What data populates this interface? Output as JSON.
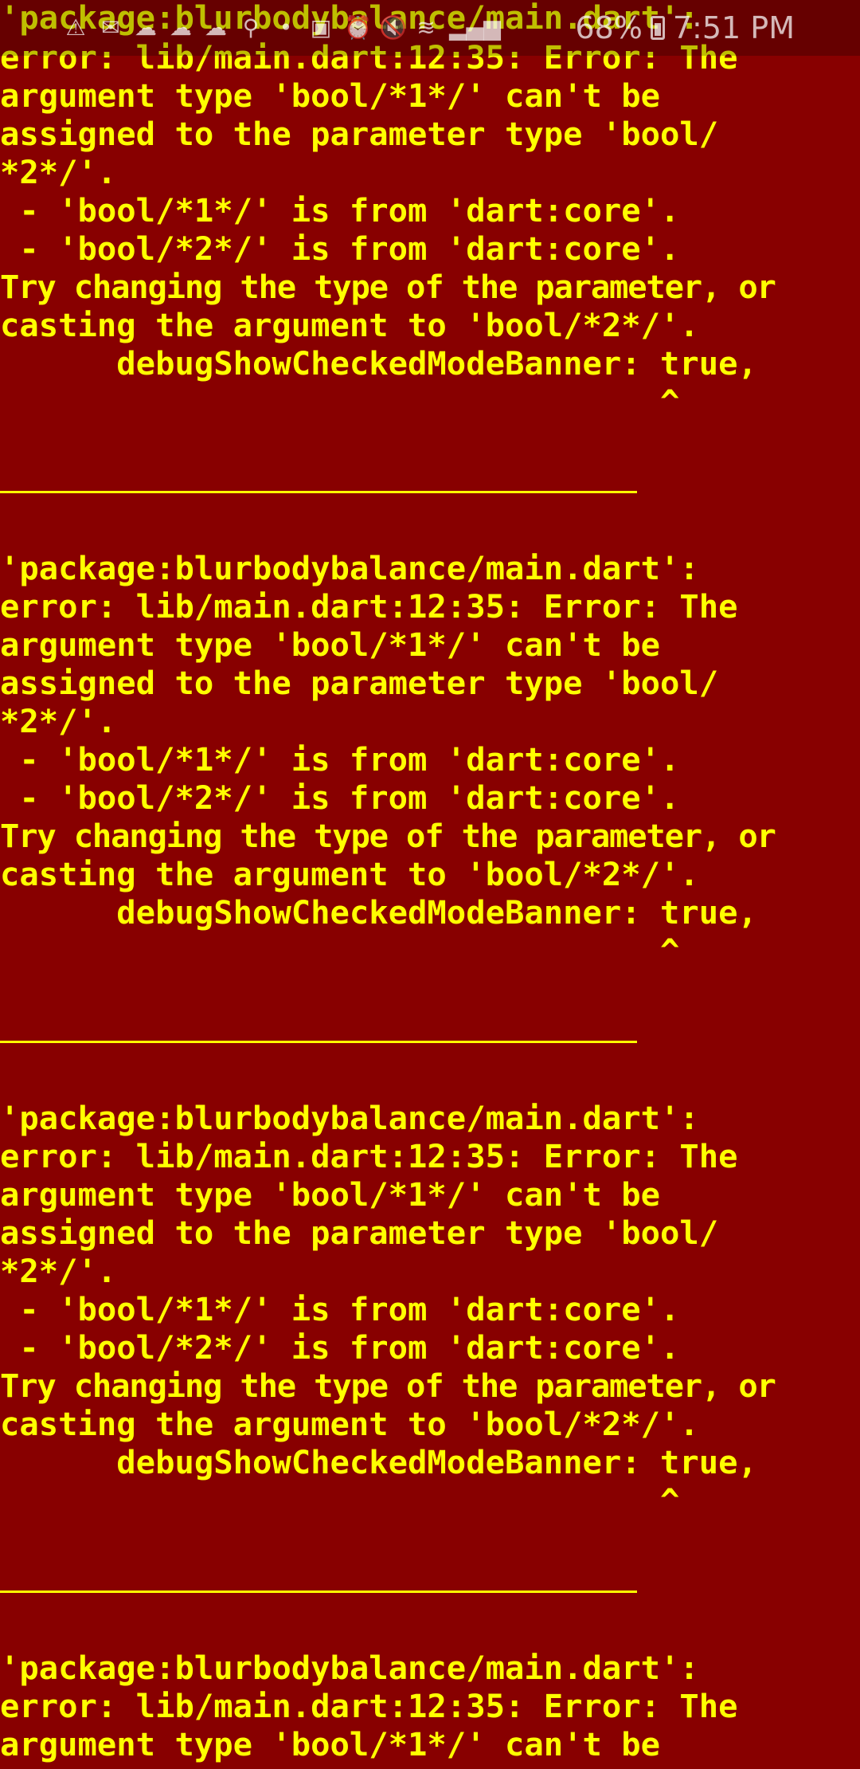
{
  "status_bar": {
    "battery": "68%",
    "time": "7:51 PM",
    "icons": [
      "warning-icon",
      "message-icon",
      "cloud-icon",
      "cloud-icon",
      "cloud-icon",
      "link-icon",
      "more-icon",
      "image-icon",
      "alarm-icon",
      "mute-icon",
      "wifi-icon",
      "signal-icon",
      "battery-icon"
    ]
  },
  "console": {
    "block": {
      "line1": "'package:blurbodybalance/main.dart':",
      "line2": "error: lib/main.dart:12:35: Error: The",
      "line3": "argument type 'bool/*1*/' can't be",
      "line4": "assigned to the parameter type 'bool/",
      "line5": "*2*/'.",
      "line6": " - 'bool/*1*/' is from 'dart:core'.",
      "line7": " - 'bool/*2*/' is from 'dart:core'.",
      "line8": "Try changing the type of the parameter, or",
      "line9": "casting the argument to 'bool/*2*/'.",
      "line10": "      debugShowCheckedModeBanner: true,",
      "line11": "                                  ^"
    }
  },
  "colors": {
    "background": "#880000",
    "text": "#ffff00"
  }
}
